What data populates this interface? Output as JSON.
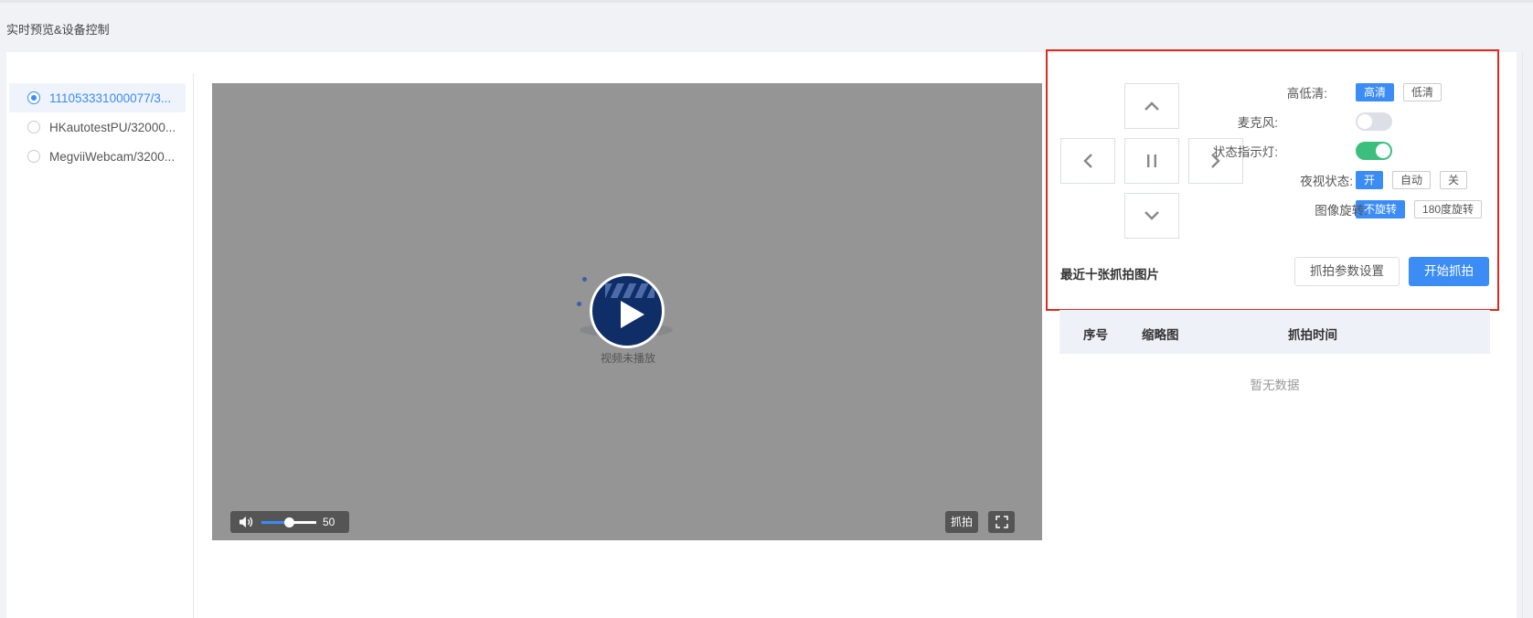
{
  "page": {
    "title": "实时预览&设备控制"
  },
  "devices": [
    {
      "label": "111053331000077/3...",
      "selected": true
    },
    {
      "label": "HKautotestPU/32000...",
      "selected": false
    },
    {
      "label": "MegviiWebcam/3200...",
      "selected": false
    }
  ],
  "video": {
    "placeholder_text": "视频未播放",
    "volume": 50,
    "volume_label": "50",
    "snapshot_label": "抓拍"
  },
  "controls": {
    "quality": {
      "label": "高低清:",
      "options": [
        "高清",
        "低清"
      ],
      "selected": "高清"
    },
    "microphone": {
      "label": "麦克风:",
      "on": false
    },
    "indicator_light": {
      "label": "状态指示灯:",
      "on": true
    },
    "night_vision": {
      "label": "夜视状态:",
      "options": [
        "开",
        "自动",
        "关"
      ],
      "selected": "开"
    },
    "rotation": {
      "label": "图像旋转:",
      "options": [
        "不旋转",
        "180度旋转"
      ],
      "selected": "不旋转"
    }
  },
  "snapshots": {
    "title": "最近十张抓拍图片",
    "settings_button": "抓拍参数设置",
    "start_button": "开始抓拍",
    "columns": [
      "序号",
      "缩略图",
      "抓拍时间"
    ],
    "empty_text": "暂无数据"
  },
  "colors": {
    "accent": "#3b8cf5",
    "toggle_on": "#3cbf7c",
    "highlight_border": "#e1291d"
  }
}
